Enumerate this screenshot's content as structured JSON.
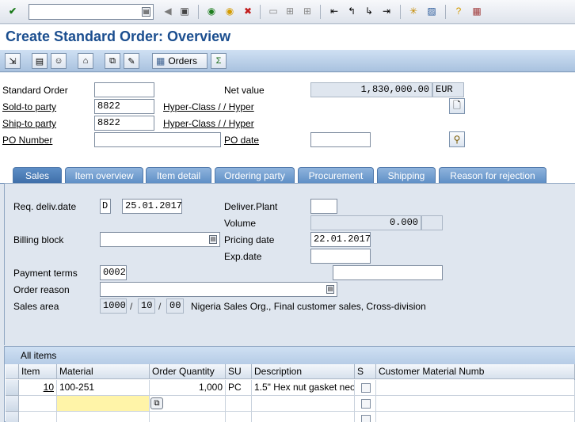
{
  "system_toolbar": {
    "command_field_value": "",
    "icons": [
      "enter-icon",
      "back-icon",
      "exit-icon",
      "cancel-icon",
      "print-icon",
      "find-icon",
      "find-next-icon",
      "first-page-icon",
      "prev-page-icon",
      "next-page-icon",
      "last-page-icon",
      "new-session-icon",
      "shortcut-icon",
      "help-icon",
      "layout-icon"
    ]
  },
  "title": "Create Standard Order: Overview",
  "app_toolbar": {
    "orders_label": "Orders"
  },
  "header": {
    "standard_order_label": "Standard Order",
    "standard_order_value": "",
    "net_value_label": "Net value",
    "net_value": "1,830,000.00",
    "currency": "EUR",
    "sold_to_label": "Sold-to party",
    "sold_to_value": "8822",
    "sold_to_name": "Hyper-Class / / Hyper",
    "ship_to_label": "Ship-to party",
    "ship_to_value": "8822",
    "ship_to_name": "Hyper-Class / / Hyper",
    "po_number_label": "PO Number",
    "po_number_value": "",
    "po_date_label": "PO date",
    "po_date_value": ""
  },
  "tabs": [
    {
      "label": "Sales",
      "active": true
    },
    {
      "label": "Item overview",
      "active": false
    },
    {
      "label": "Item detail",
      "active": false
    },
    {
      "label": "Ordering party",
      "active": false
    },
    {
      "label": "Procurement",
      "active": false
    },
    {
      "label": "Shipping",
      "active": false
    },
    {
      "label": "Reason for rejection",
      "active": false
    }
  ],
  "sales": {
    "req_deliv_label": "Req. deliv.date",
    "req_deliv_format": "D",
    "req_deliv_date": "25.01.2017",
    "deliver_plant_label": "Deliver.Plant",
    "deliver_plant_value": "",
    "volume_label": "Volume",
    "volume_value": "0.000",
    "volume_unit": "",
    "billing_block_label": "Billing block",
    "billing_block_value": "",
    "pricing_date_label": "Pricing date",
    "pricing_date_value": "22.01.2017",
    "exp_date_label": "Exp.date",
    "exp_date_value": "",
    "payment_terms_label": "Payment terms",
    "payment_terms_value": "0002",
    "payment_terms_text": "",
    "order_reason_label": "Order reason",
    "order_reason_value": "",
    "sales_area_label": "Sales area",
    "sales_org": "1000",
    "distr_channel": "10",
    "division": "00",
    "sales_area_text": "Nigeria Sales Org., Final customer sales, Cross-division"
  },
  "items": {
    "title": "All items",
    "columns": [
      "Item",
      "Material",
      "Order Quantity",
      "SU",
      "Description",
      "S",
      "Customer Material Numb"
    ],
    "rows": [
      {
        "item": "10",
        "material": "100-251",
        "qty": "1,000",
        "su": "PC",
        "description": "1.5\" Hex nut gasket neo",
        "s": false,
        "cust_mat": ""
      },
      {
        "item": "",
        "material": "",
        "qty": "",
        "su": "",
        "description": "",
        "s": false,
        "cust_mat": ""
      },
      {
        "item": "",
        "material": "",
        "qty": "",
        "su": "",
        "description": "",
        "s": false,
        "cust_mat": ""
      }
    ]
  },
  "colors": {
    "title": "#1b4e8f",
    "tab_bg": "#6f9bd0",
    "pane_bg": "#dfe6ef",
    "active_cell": "#fff4a8"
  }
}
